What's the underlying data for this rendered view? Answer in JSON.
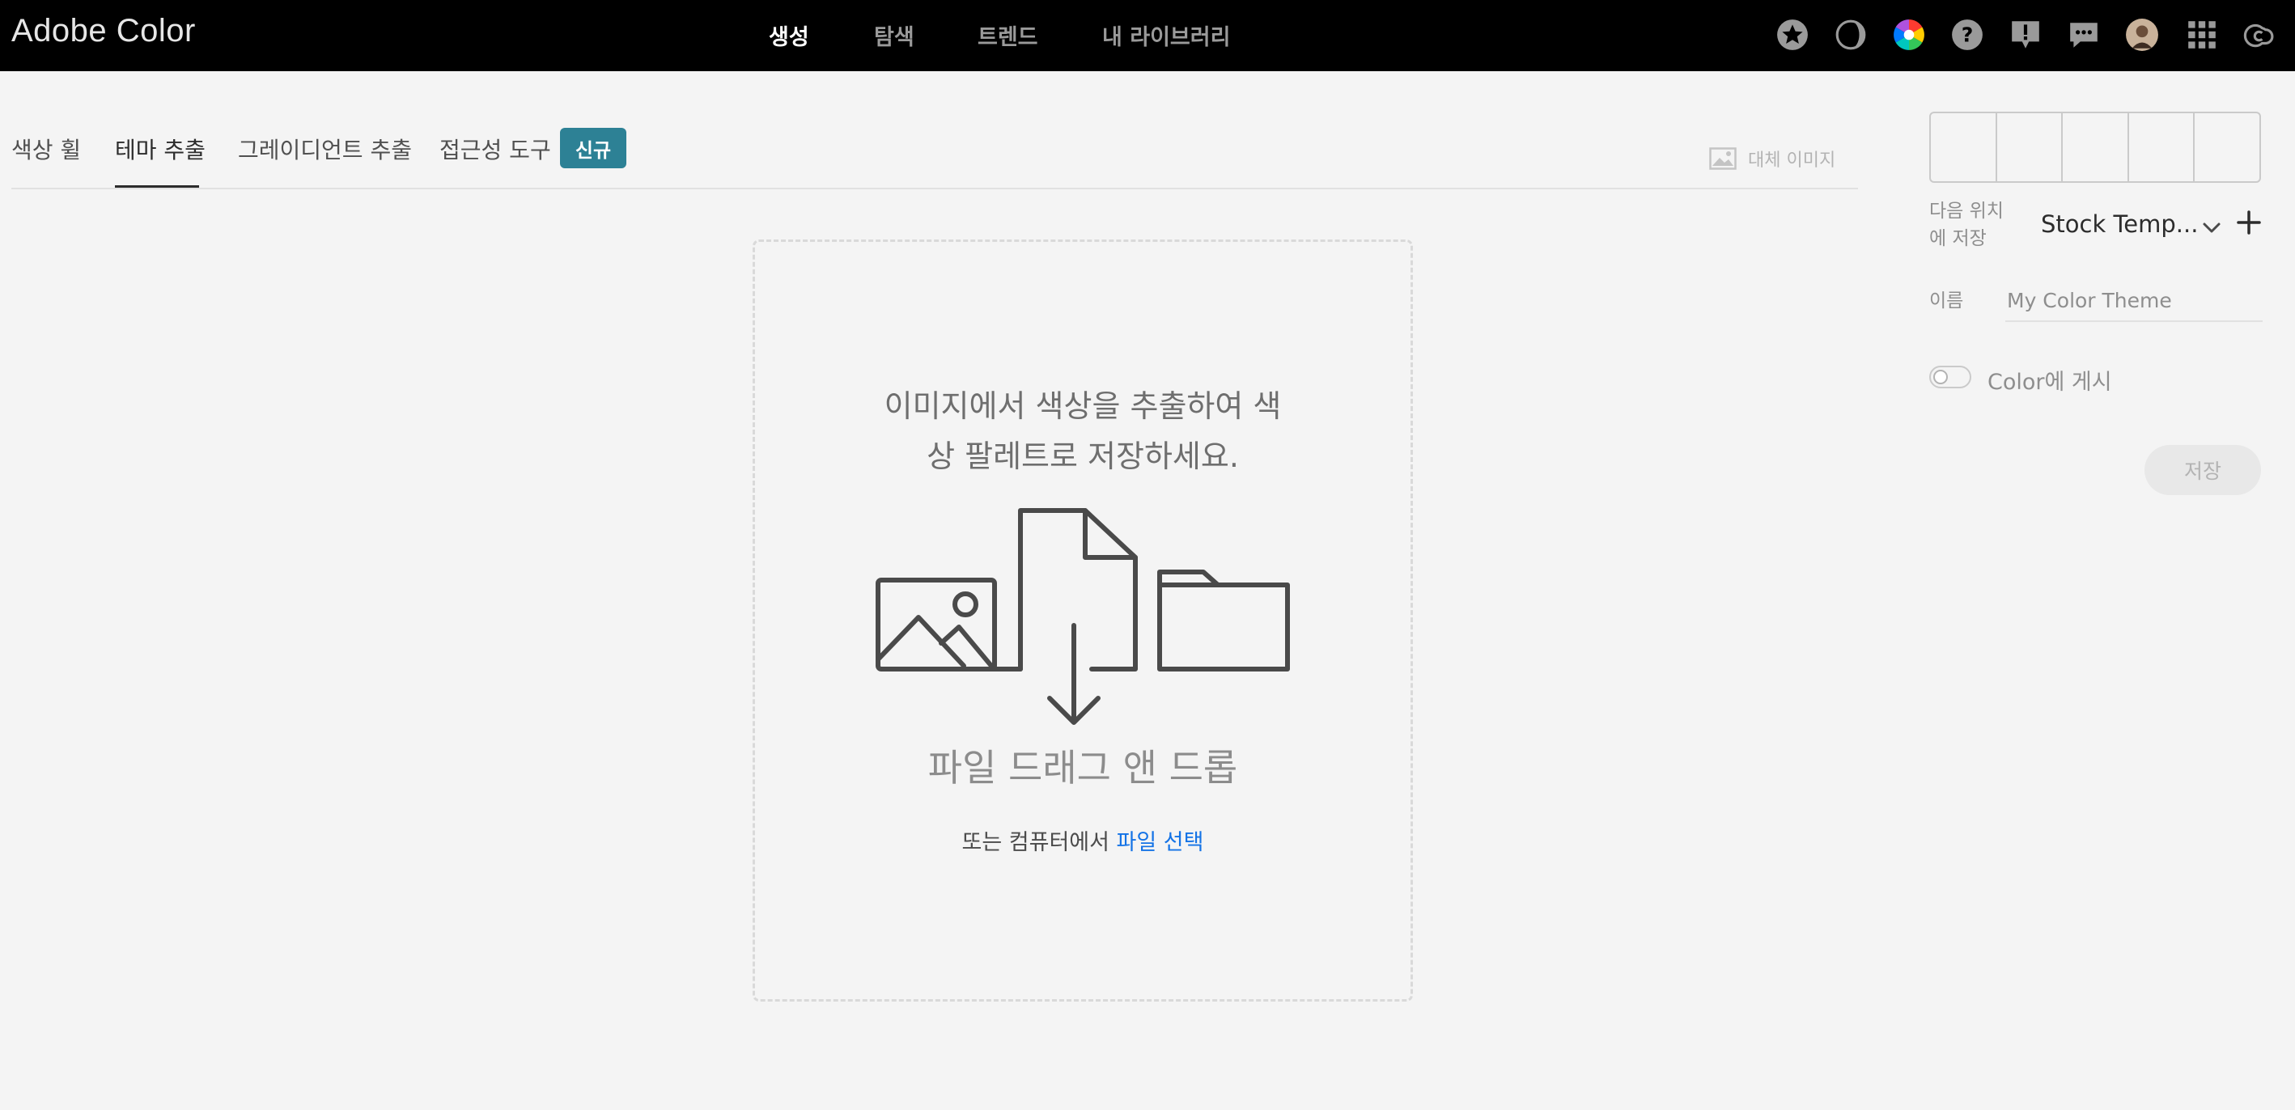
{
  "header": {
    "brand": "Adobe Color",
    "nav": [
      {
        "label": "생성",
        "active": true
      },
      {
        "label": "탐색",
        "active": false
      },
      {
        "label": "트렌드",
        "active": false
      },
      {
        "label": "내 라이브러리",
        "active": false
      }
    ],
    "icons": [
      "star-badge-icon",
      "contrast-icon",
      "color-wheel-icon",
      "help-icon",
      "feedback-icon",
      "chat-icon",
      "avatar",
      "apps-grid-icon",
      "creative-cloud-icon"
    ]
  },
  "tabs": {
    "items": [
      {
        "label": "색상 휠",
        "active": false
      },
      {
        "label": "테마 추출",
        "active": true
      },
      {
        "label": "그레이디언트 추출",
        "active": false
      },
      {
        "label": "접근성 도구",
        "active": false
      }
    ],
    "new_badge": "신규",
    "alt_image": "대체 이미지"
  },
  "dropzone": {
    "heading_line1": "이미지에서 색상을 추출하여 색",
    "heading_line2": "상 팔레트로 저장하세요.",
    "drag_text": "파일 드래그 앤 드롭",
    "or_text": "또는 컴퓨터에서 ",
    "link_text": "파일 선택"
  },
  "panel": {
    "save_to_label": "다음 위치\n에 저장",
    "library": "Stock Temp...",
    "name_label": "이름",
    "name_placeholder": "My Color Theme",
    "publish_label": "Color에 게시",
    "save_button": "저장"
  },
  "colors": {
    "topbar": "#000000",
    "background": "#f4f4f4",
    "badge": "#2d8195",
    "link": "#1473e6"
  }
}
